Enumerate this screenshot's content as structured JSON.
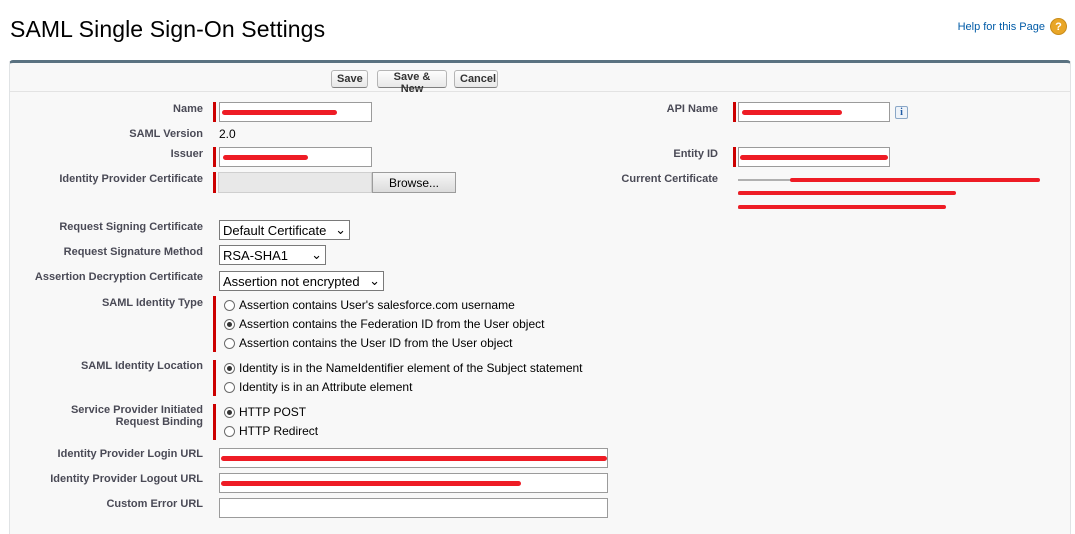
{
  "header": {
    "title": "SAML Single Sign-On Settings",
    "help_label": "Help for this Page",
    "help_icon": "question-mark-icon"
  },
  "toolbar": {
    "save_label": "Save",
    "save_new_label": "Save & New",
    "cancel_label": "Cancel"
  },
  "fields": {
    "name_label": "Name",
    "saml_version_label": "SAML Version",
    "saml_version_value": "2.0",
    "issuer_label": "Issuer",
    "idp_cert_label": "Identity Provider Certificate",
    "browse_label": "Browse...",
    "api_name_label": "API Name",
    "entity_id_label": "Entity ID",
    "current_cert_label": "Current Certificate",
    "req_sign_cert_label": "Request Signing Certificate",
    "req_sign_cert_value": "Default Certificate",
    "req_sig_method_label": "Request Signature Method",
    "req_sig_method_value": "RSA-SHA1",
    "assert_decrypt_label": "Assertion Decryption Certificate",
    "assert_decrypt_value": "Assertion not encrypted",
    "identity_type_label": "SAML Identity Type",
    "identity_type_options": [
      "Assertion contains User's salesforce.com username",
      "Assertion contains the Federation ID from the User object",
      "Assertion contains the User ID from the User object"
    ],
    "identity_type_selected": 1,
    "identity_location_label": "SAML Identity Location",
    "identity_location_options": [
      "Identity is in the NameIdentifier element of the Subject statement",
      "Identity is in an Attribute element"
    ],
    "identity_location_selected": 0,
    "sp_binding_label_line1": "Service Provider Initiated",
    "sp_binding_label_line2": "Request Binding",
    "sp_binding_options": [
      "HTTP POST",
      "HTTP Redirect"
    ],
    "sp_binding_selected": 0,
    "idp_login_url_label": "Identity Provider Login URL",
    "idp_logout_url_label": "Identity Provider Logout URL",
    "custom_error_url_label": "Custom Error URL",
    "custom_error_url_value": ""
  },
  "colors": {
    "required_bar": "#cc0000",
    "redaction": "#ee1c25",
    "panel_border": "#5a7281",
    "link": "#015ba7"
  }
}
